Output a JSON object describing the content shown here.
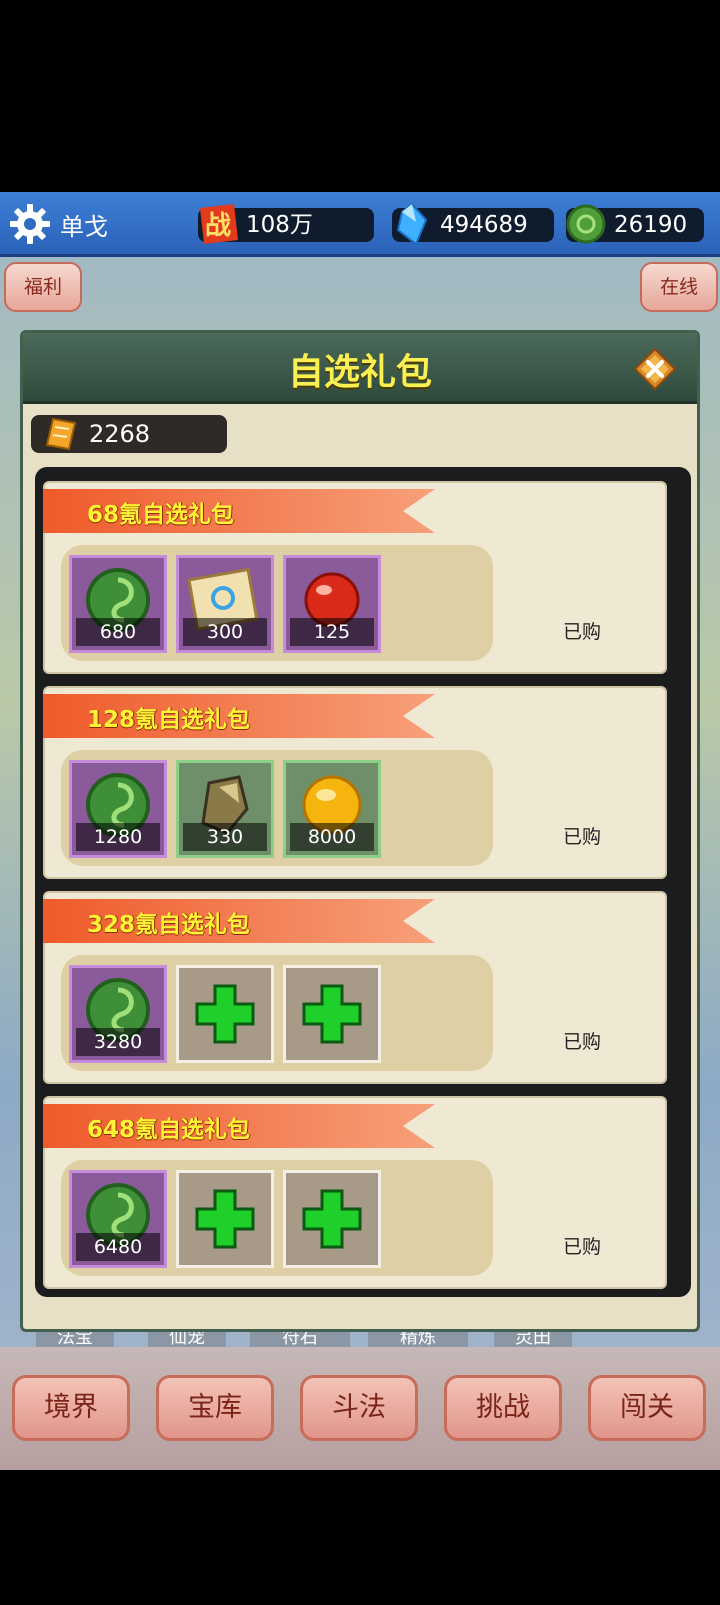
{
  "player": {
    "name": "单戈"
  },
  "resources": [
    {
      "icon": "battle-power-icon",
      "value": "108万"
    },
    {
      "icon": "blue-crystal-icon",
      "value": "494689"
    },
    {
      "icon": "green-jade-icon",
      "value": "26190"
    }
  ],
  "side_buttons": {
    "left": "福利",
    "right": "在线"
  },
  "dialog": {
    "title": "自选礼包",
    "ticket_icon": "ticket-icon",
    "ticket_value": "2268",
    "packs": [
      {
        "title": "68氪自选礼包",
        "status": "已购",
        "items": [
          {
            "icon": "green-jade-icon",
            "rarity": "purple",
            "qty": "680"
          },
          {
            "icon": "scroll-icon",
            "rarity": "purple",
            "qty": "300"
          },
          {
            "icon": "red-orb-icon",
            "rarity": "purple",
            "qty": "125"
          }
        ]
      },
      {
        "title": "128氪自选礼包",
        "status": "已购",
        "items": [
          {
            "icon": "green-jade-icon",
            "rarity": "purple",
            "qty": "1280"
          },
          {
            "icon": "stone-icon",
            "rarity": "green",
            "qty": "330"
          },
          {
            "icon": "gold-orb-icon",
            "rarity": "green",
            "qty": "8000"
          }
        ]
      },
      {
        "title": "328氪自选礼包",
        "status": "已购",
        "items": [
          {
            "icon": "green-jade-icon",
            "rarity": "purple",
            "qty": "3280"
          },
          {
            "icon": "plus-icon",
            "rarity": "empty",
            "qty": ""
          },
          {
            "icon": "plus-icon",
            "rarity": "empty",
            "qty": ""
          }
        ]
      },
      {
        "title": "648氪自选礼包",
        "status": "已购",
        "items": [
          {
            "icon": "green-jade-icon",
            "rarity": "purple",
            "qty": "6480"
          },
          {
            "icon": "plus-icon",
            "rarity": "empty",
            "qty": ""
          },
          {
            "icon": "plus-icon",
            "rarity": "empty",
            "qty": ""
          }
        ]
      }
    ]
  },
  "bg_tabs": [
    "法宝",
    "仙宠",
    "符石",
    "精炼",
    "灵田"
  ],
  "bottom_nav": [
    "境界",
    "宝库",
    "斗法",
    "挑战",
    "闯关"
  ],
  "colors": {
    "title_yellow": "#fbf052",
    "ribbon": "#ef6a3a",
    "rarity_purple": "#8a5a9a",
    "rarity_green": "#6f8f6a"
  }
}
